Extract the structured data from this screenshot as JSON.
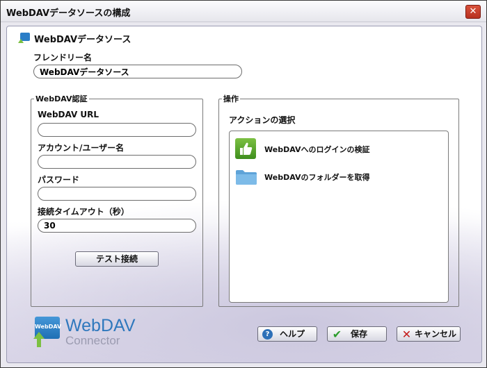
{
  "window": {
    "title": "WebDAVデータソースの構成"
  },
  "header": {
    "icon": "webdav-small-icon",
    "title": "WebDAVデータソース"
  },
  "friendly_name": {
    "label": "フレンドリー名",
    "value": "WebDAVデータソース"
  },
  "auth": {
    "legend": "WebDAV認証",
    "url_label": "WebDAV URL",
    "url_value": "",
    "account_label": "アカウント/ユーザー名",
    "account_value": "",
    "password_label": "パスワード",
    "password_value": "",
    "timeout_label": "接続タイムアウト（秒）",
    "timeout_value": "30",
    "test_button": "テスト接続"
  },
  "operations": {
    "legend": "操作",
    "select_label": "アクションの選択",
    "actions": [
      {
        "label": "WebDAVへのログインの検証",
        "icon": "thumbs-up-icon"
      },
      {
        "label": "WebDAVのフォルダーを取得",
        "icon": "folder-icon"
      }
    ]
  },
  "logo": {
    "line1": "WebDAV",
    "line2": "Connector",
    "badge": "WebDAV"
  },
  "footer": {
    "help": "ヘルプ",
    "save": "保存",
    "cancel": "キャンセル"
  },
  "colors": {
    "accent": "#2f78bd",
    "green": "#5aa82a"
  }
}
